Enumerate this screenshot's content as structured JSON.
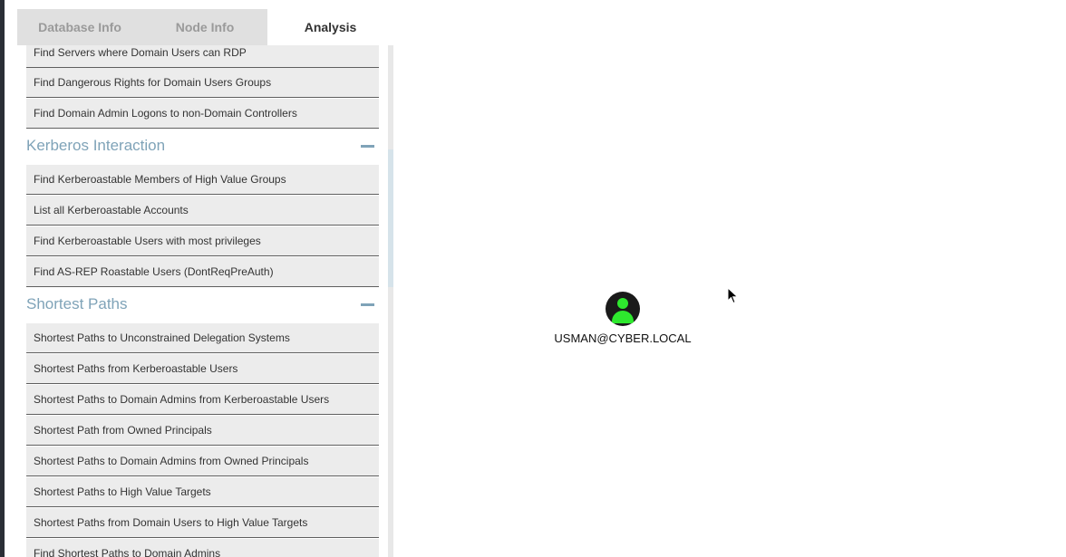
{
  "tabs": [
    "Database Info",
    "Node Info",
    "Analysis"
  ],
  "queries_top": [
    "Find Servers where Domain Users can RDP",
    "Find Dangerous Rights for Domain Users Groups",
    "Find Domain Admin Logons to non-Domain Controllers"
  ],
  "sections": [
    {
      "title": "Kerberos Interaction",
      "queries": [
        "Find Kerberoastable Members of High Value Groups",
        "List all Kerberoastable Accounts",
        "Find Kerberoastable Users with most privileges",
        "Find AS-REP Roastable Users (DontReqPreAuth)"
      ]
    },
    {
      "title": "Shortest Paths",
      "queries": [
        "Shortest Paths to Unconstrained Delegation Systems",
        "Shortest Paths from Kerberoastable Users",
        "Shortest Paths to Domain Admins from Kerberoastable Users",
        "Shortest Path from Owned Principals",
        "Shortest Paths to Domain Admins from Owned Principals",
        "Shortest Paths to High Value Targets",
        "Shortest Paths from Domain Users to High Value Targets",
        "Find Shortest Paths to Domain Admins"
      ]
    }
  ],
  "graph": {
    "node_label": "USMAN@CYBER.LOCAL",
    "node_icon": "user-icon",
    "node_color": "#2ee82e"
  }
}
